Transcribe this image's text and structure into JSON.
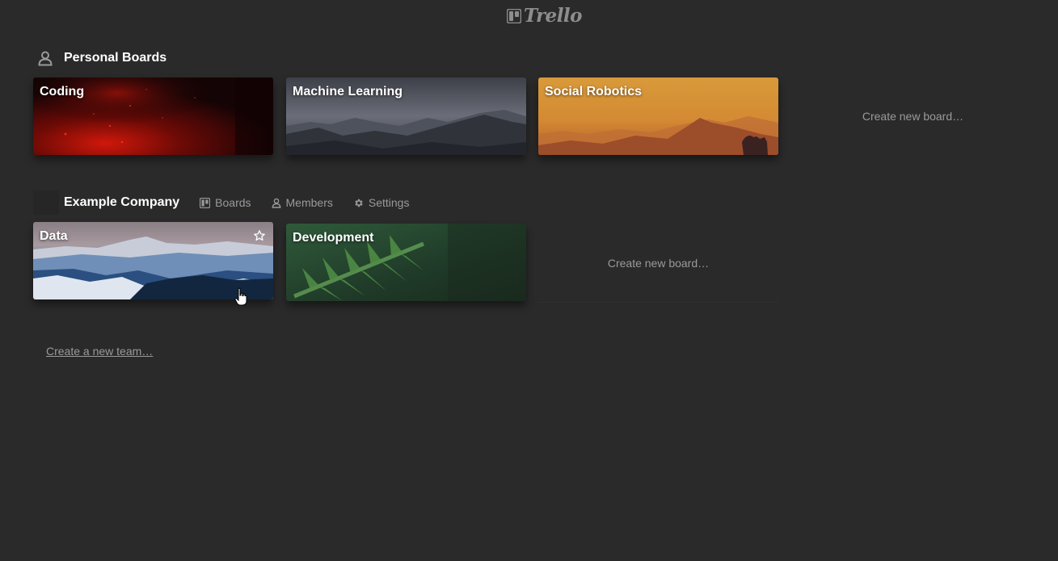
{
  "header": {
    "logo_text": "Trello",
    "logo_icon": "trello-board-icon"
  },
  "personal": {
    "icon": "person-icon",
    "title": "Personal Boards",
    "boards": [
      {
        "title": "Coding"
      },
      {
        "title": "Machine Learning"
      },
      {
        "title": "Social Robotics"
      }
    ],
    "create_label": "Create new board…"
  },
  "team": {
    "title": "Example Company",
    "links": {
      "boards": "Boards",
      "members": "Members",
      "settings": "Settings"
    },
    "boards": [
      {
        "title": "Data",
        "starred_icon": "star-outline-icon"
      },
      {
        "title": "Development"
      }
    ],
    "create_label": "Create new board…"
  },
  "create_team_label": "Create a new team…",
  "colors": {
    "background": "#2a2a2a",
    "muted_text": "#9a9a9a",
    "logo": "#8d8d8d"
  }
}
